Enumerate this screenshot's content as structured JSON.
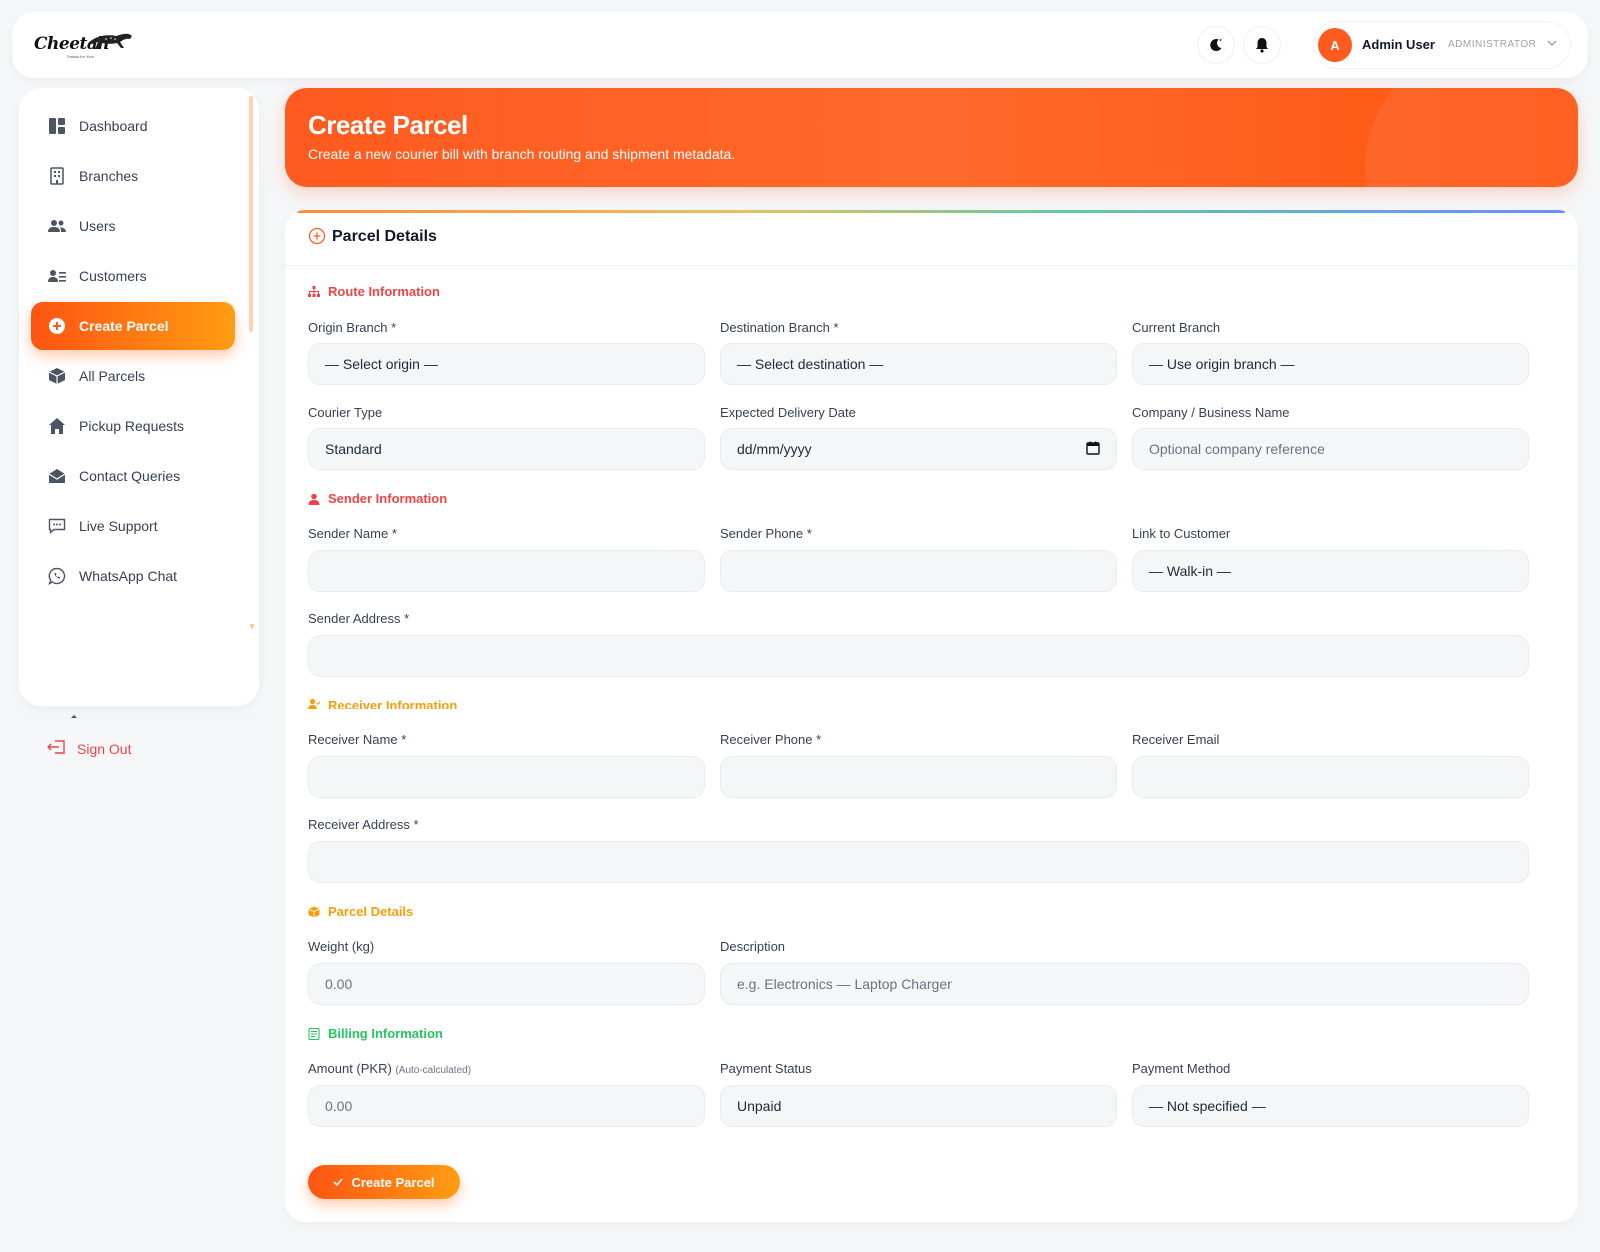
{
  "app": {
    "logo_text": "Cheetah",
    "logo_tagline": "Thanks for Your"
  },
  "header": {
    "theme_icon": "moon-icon",
    "notifications_icon": "bell-icon",
    "user": {
      "avatar_initial": "A",
      "name": "Admin User",
      "role": "ADMINISTRATOR"
    }
  },
  "sidebar": {
    "items": [
      {
        "label": "Dashboard",
        "icon": "dashboard-icon"
      },
      {
        "label": "Branches",
        "icon": "building-icon"
      },
      {
        "label": "Users",
        "icon": "users-icon"
      },
      {
        "label": "Customers",
        "icon": "customers-icon"
      },
      {
        "label": "Create Parcel",
        "icon": "plus-circle-icon",
        "active": true
      },
      {
        "label": "All Parcels",
        "icon": "box-icon"
      },
      {
        "label": "Pickup Requests",
        "icon": "home-icon"
      },
      {
        "label": "Contact Queries",
        "icon": "mail-icon"
      },
      {
        "label": "Live Support",
        "icon": "chat-icon"
      },
      {
        "label": "WhatsApp Chat",
        "icon": "whatsapp-icon"
      }
    ],
    "signout_label": "Sign Out"
  },
  "hero": {
    "title": "Create Parcel",
    "subtitle": "Create a new courier bill with branch routing and shipment metadata."
  },
  "form": {
    "title": "Parcel Details",
    "sections": {
      "route": "Route Information",
      "sender": "Sender Information",
      "receiver": "Receiver Information",
      "parcel": "Parcel Details",
      "billing": "Billing Information"
    },
    "fields": {
      "origin_branch": {
        "label": "Origin Branch *",
        "value": "— Select origin —"
      },
      "destination_branch": {
        "label": "Destination Branch *",
        "value": "— Select destination —"
      },
      "current_branch": {
        "label": "Current Branch",
        "value": "— Use origin branch —"
      },
      "courier_type": {
        "label": "Courier Type",
        "value": "Standard"
      },
      "expected_delivery": {
        "label": "Expected Delivery Date",
        "placeholder": "dd/mm/yyyy"
      },
      "company_name": {
        "label": "Company / Business Name",
        "placeholder": "Optional company reference"
      },
      "sender_name": {
        "label": "Sender Name *",
        "value": ""
      },
      "sender_phone": {
        "label": "Sender Phone *",
        "value": ""
      },
      "link_customer": {
        "label": "Link to Customer",
        "value": "— Walk-in —"
      },
      "sender_address": {
        "label": "Sender Address *",
        "value": ""
      },
      "receiver_name": {
        "label": "Receiver Name *",
        "value": ""
      },
      "receiver_phone": {
        "label": "Receiver Phone *",
        "value": ""
      },
      "receiver_email": {
        "label": "Receiver Email",
        "value": ""
      },
      "receiver_address": {
        "label": "Receiver Address *",
        "value": ""
      },
      "weight": {
        "label": "Weight (kg)",
        "placeholder": "0.00"
      },
      "description": {
        "label": "Description",
        "placeholder": "e.g. Electronics — Laptop Charger"
      },
      "amount": {
        "label": "Amount (PKR)",
        "note": "(Auto-calculated)",
        "placeholder": "0.00"
      },
      "payment_status": {
        "label": "Payment Status",
        "value": "Unpaid"
      },
      "payment_method": {
        "label": "Payment Method",
        "value": "— Not specified —"
      }
    },
    "submit_label": "Create Parcel"
  },
  "colors": {
    "accent": "#ff5a1f",
    "accent_end": "#ff9d12",
    "route_section": "#ef4444",
    "sender_section": "#ef4444",
    "receiver_section": "#f59e0b",
    "parcel_section": "#f59e0b",
    "billing_section": "#22c55e",
    "signout": "#ef4444"
  }
}
